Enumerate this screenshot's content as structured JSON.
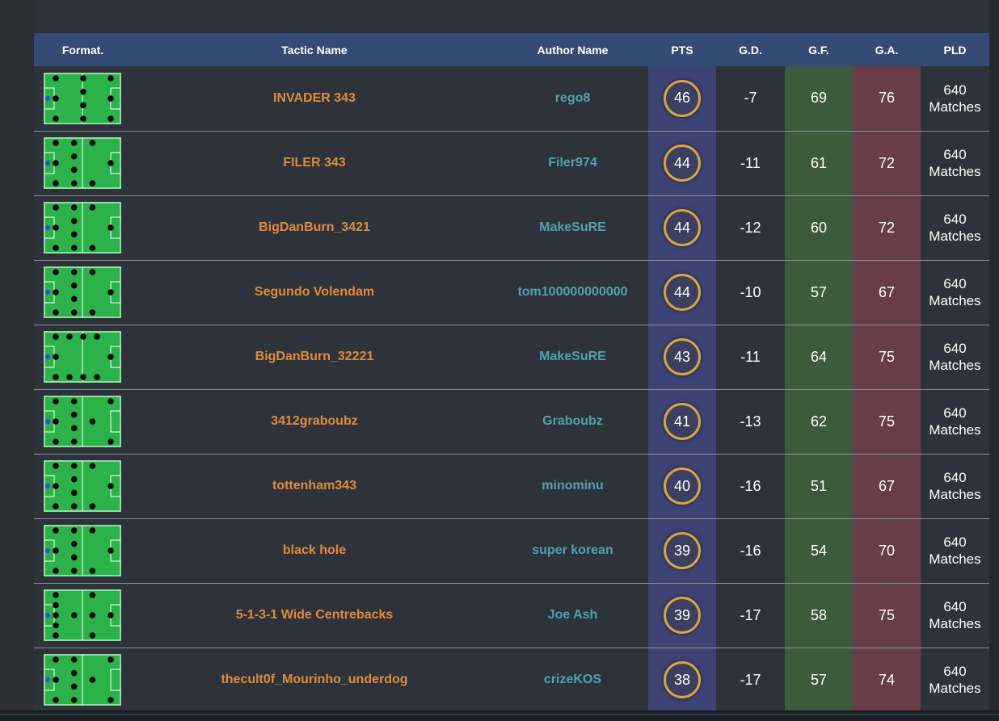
{
  "columns": {
    "format": "Format.",
    "tactic": "Tactic Name",
    "author": "Author Name",
    "pts": "PTS",
    "gd": "G.D.",
    "gf": "G.F.",
    "ga": "G.A.",
    "pld": "PLD"
  },
  "colors": {
    "header_bg": "#354b74",
    "pts_bg": "#3d4375",
    "gf_bg": "#3c5a3c",
    "ga_bg": "#683d47",
    "tactic_text": "#e08a3c",
    "author_text": "#4fa3ad",
    "badge_ring": "#d9a441",
    "pitch": "#2bb34a"
  },
  "rows": [
    {
      "tactic": "INVADER 343",
      "author": "rego8",
      "pts": "46",
      "gd": "-7",
      "gf": "69",
      "ga": "76",
      "pld_count": "640",
      "pld_unit": "Matches",
      "formation": [
        [
          1
        ],
        [
          3
        ],
        [
          4
        ],
        [
          3
        ]
      ]
    },
    {
      "tactic": "FILER 343",
      "author": "Filer974",
      "pts": "44",
      "gd": "-11",
      "gf": "61",
      "ga": "72",
      "pld_count": "640",
      "pld_unit": "Matches",
      "formation": [
        [
          1
        ],
        [
          3
        ],
        [
          4
        ],
        [
          2
        ],
        [
          1
        ]
      ]
    },
    {
      "tactic": "BigDanBurn_3421",
      "author": "MakeSuRE",
      "pts": "44",
      "gd": "-12",
      "gf": "60",
      "ga": "72",
      "pld_count": "640",
      "pld_unit": "Matches",
      "formation": [
        [
          1
        ],
        [
          3
        ],
        [
          4
        ],
        [
          2
        ],
        [
          1
        ]
      ]
    },
    {
      "tactic": "Segundo Volendam",
      "author": "tom100000000000",
      "pts": "44",
      "gd": "-10",
      "gf": "57",
      "ga": "67",
      "pld_count": "640",
      "pld_unit": "Matches",
      "formation": [
        [
          1
        ],
        [
          3
        ],
        [
          4
        ],
        [
          2
        ],
        [
          1
        ]
      ]
    },
    {
      "tactic": "BigDanBurn_32221",
      "author": "MakeSuRE",
      "pts": "43",
      "gd": "-11",
      "gf": "64",
      "ga": "75",
      "pld_count": "640",
      "pld_unit": "Matches",
      "formation": [
        [
          1
        ],
        [
          3
        ],
        [
          2
        ],
        [
          2
        ],
        [
          2
        ],
        [
          1
        ]
      ]
    },
    {
      "tactic": "3412graboubz",
      "author": "Graboubz",
      "pts": "41",
      "gd": "-13",
      "gf": "62",
      "ga": "75",
      "pld_count": "640",
      "pld_unit": "Matches",
      "formation": [
        [
          1
        ],
        [
          3
        ],
        [
          4
        ],
        [
          1
        ],
        [
          2
        ]
      ]
    },
    {
      "tactic": "tottenham343",
      "author": "minominu",
      "pts": "40",
      "gd": "-16",
      "gf": "51",
      "ga": "67",
      "pld_count": "640",
      "pld_unit": "Matches",
      "formation": [
        [
          1
        ],
        [
          3
        ],
        [
          4
        ],
        [
          2
        ],
        [
          1
        ]
      ]
    },
    {
      "tactic": "black hole",
      "author": "super korean",
      "pts": "39",
      "gd": "-16",
      "gf": "54",
      "ga": "70",
      "pld_count": "640",
      "pld_unit": "Matches",
      "formation": [
        [
          1
        ],
        [
          3
        ],
        [
          4
        ],
        [
          2
        ],
        [
          1
        ]
      ]
    },
    {
      "tactic": "5-1-3-1 Wide Centrebacks",
      "author": "Joe Ash",
      "pts": "39",
      "gd": "-17",
      "gf": "58",
      "ga": "75",
      "pld_count": "640",
      "pld_unit": "Matches",
      "formation": [
        [
          1
        ],
        [
          5
        ],
        [
          1
        ],
        [
          3
        ],
        [
          1
        ]
      ]
    },
    {
      "tactic": "thecult0f_Mourinho_underdog",
      "author": "crizeKOS",
      "pts": "38",
      "gd": "-17",
      "gf": "57",
      "ga": "74",
      "pld_count": "640",
      "pld_unit": "Matches",
      "formation": [
        [
          1
        ],
        [
          3
        ],
        [
          4
        ],
        [
          1
        ],
        [
          2
        ]
      ]
    }
  ]
}
